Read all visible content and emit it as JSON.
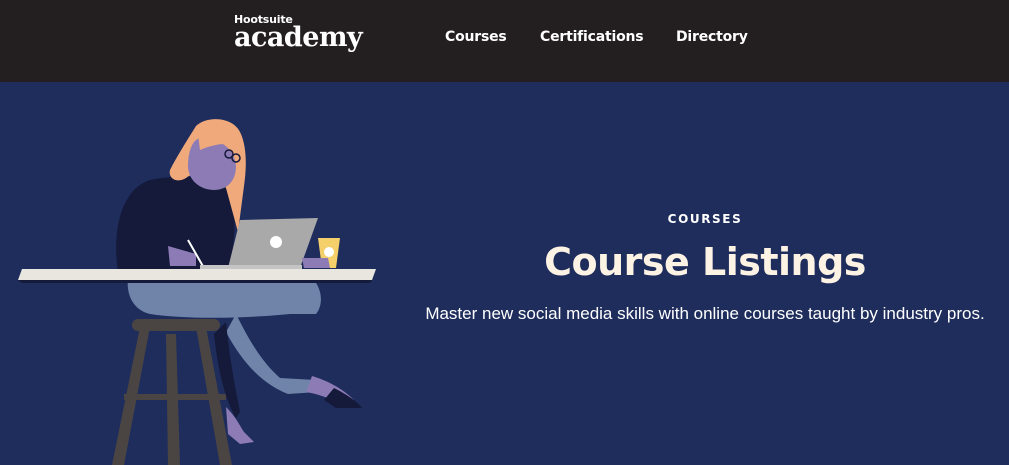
{
  "header": {
    "logo_small": "Hootsuite",
    "logo_main": "academy",
    "nav": [
      {
        "label": "Courses"
      },
      {
        "label": "Certifications"
      },
      {
        "label": "Directory"
      }
    ]
  },
  "hero": {
    "eyebrow": "COURSES",
    "title": "Course Listings",
    "subtitle": "Master new social media skills with online courses taught by industry pros.",
    "illustration_icon": "person-at-laptop-illustration"
  },
  "colors": {
    "header_bg": "#231f20",
    "hero_bg": "#1e2d5c",
    "title_color": "#fdf3e4",
    "hair": "#f0a97b",
    "skin": "#8d7bb6",
    "shirt": "#15193a",
    "pants": "#6f84a8",
    "laptop": "#a9a9a9",
    "stool": "#4a4543"
  }
}
